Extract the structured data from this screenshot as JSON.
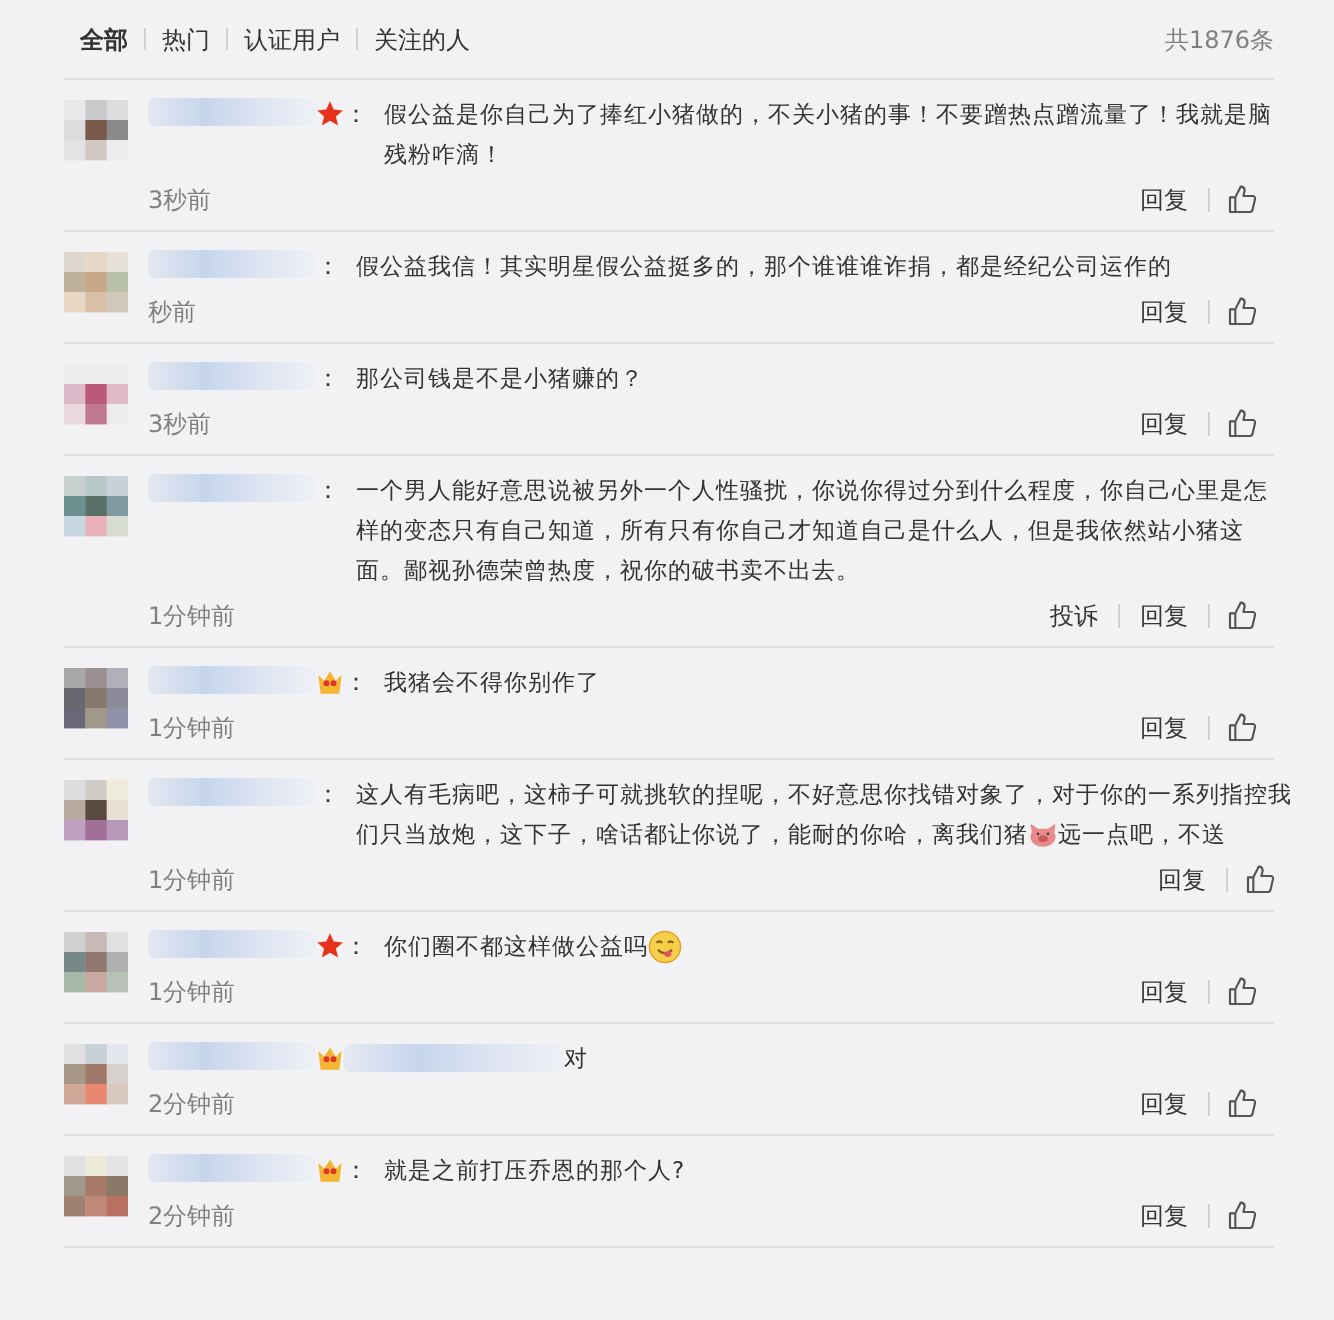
{
  "tabs": [
    {
      "label": "全部",
      "selected": true
    },
    {
      "label": "热门",
      "selected": false
    },
    {
      "label": "认证用户",
      "selected": false
    },
    {
      "label": "关注的人",
      "selected": false
    }
  ],
  "total": "共1876条",
  "comments": [
    {
      "star_badge": true,
      "separator": "：",
      "segments": [
        {
          "kind": "text",
          "text": "假公益是你自己为了捧红小猪做的，不关小猪的事！不要蹭热点蹭流量了！我就是脑残粉咋滴！"
        }
      ],
      "time": "3秒前",
      "actions": [
        "回复"
      ]
    },
    {
      "separator": "：",
      "segments": [
        {
          "kind": "text",
          "text": "假公益我信！其实明星假公益挺多的，那个谁谁谁诈捐，都是经纪公司运作的"
        }
      ],
      "time": "秒前",
      "actions": [
        "回复"
      ]
    },
    {
      "separator": "：",
      "segments": [
        {
          "kind": "text",
          "text": "那公司钱是不是小猪赚的？"
        }
      ],
      "time": "3秒前",
      "actions": [
        "回复"
      ]
    },
    {
      "separator": "：",
      "segments": [
        {
          "kind": "text",
          "text": "一个男人能好意思说被另外一个人性骚扰，你说你得过分到什么程度，你自己心里是怎样的变态只有自己知道，所有只有你自己才知道自己是什么人，但是我依然站小猪这面。鄙视孙德荣曾热度，祝你的破书卖不出去。"
        }
      ],
      "time": "1分钟前",
      "actions": [
        "投诉",
        "回复"
      ]
    },
    {
      "crown_badge": true,
      "separator": "：",
      "segments": [
        {
          "kind": "text",
          "text": "我猪会不得你别作了"
        }
      ],
      "time": "1分钟前",
      "actions": [
        "回复"
      ]
    },
    {
      "separator": "：",
      "segments": [
        {
          "kind": "text",
          "text": "这人有毛病吧，这柿子可就挑软的捏呢，不好意思你找错对象了，对于你的一系列指控我"
        },
        {
          "kind": "text",
          "text": "们只当放炮，这下子，啥话都让你说了，能耐的你哈，离我们猪"
        },
        {
          "kind": "pig"
        },
        {
          "kind": "text",
          "text": " 远一点吧，不送"
        }
      ],
      "time": "1分钟前",
      "actions": [
        "回复"
      ]
    },
    {
      "star_badge": true,
      "separator": "：",
      "segments": [
        {
          "kind": "text",
          "text": "你们圈不都这样做公益吗"
        },
        {
          "kind": "yum"
        }
      ],
      "time": "1分钟前",
      "actions": [
        "回复"
      ]
    },
    {
      "crown_badge": true,
      "segments": [
        {
          "kind": "mention"
        },
        {
          "kind": "text",
          "text": "对"
        }
      ],
      "time": "2分钟前",
      "actions": [
        "回复"
      ]
    },
    {
      "crown_badge": true,
      "separator": "：",
      "segments": [
        {
          "kind": "text",
          "text": "就是之前打压乔恩的那个人?"
        }
      ],
      "time": "2分钟前",
      "actions": [
        "回复"
      ]
    }
  ]
}
